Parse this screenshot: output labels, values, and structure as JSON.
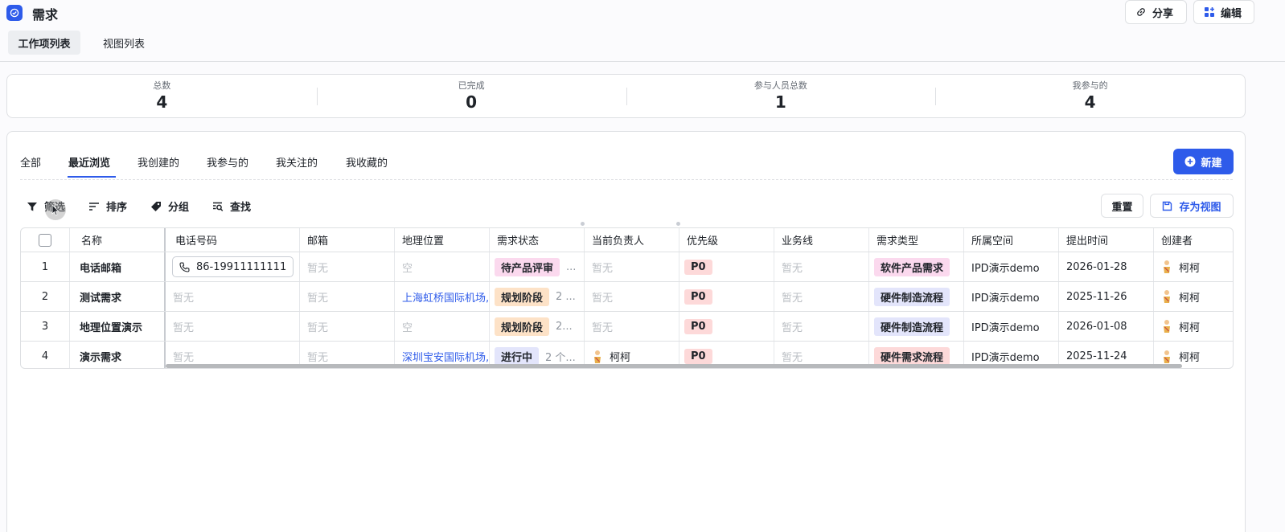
{
  "header": {
    "title": "需求",
    "share_label": "分享",
    "edit_label": "编辑"
  },
  "top_tabs": [
    {
      "label": "工作项列表"
    },
    {
      "label": "视图列表"
    }
  ],
  "stats": [
    {
      "label": "总数",
      "value": "4"
    },
    {
      "label": "已完成",
      "value": "0"
    },
    {
      "label": "参与人员总数",
      "value": "1"
    },
    {
      "label": "我参与的",
      "value": "4"
    }
  ],
  "view_tabs": [
    {
      "label": "全部"
    },
    {
      "label": "最近浏览"
    },
    {
      "label": "我创建的"
    },
    {
      "label": "我参与的"
    },
    {
      "label": "我关注的"
    },
    {
      "label": "我收藏的"
    }
  ],
  "new_label": "新建",
  "toolbar": {
    "filter": "筛选",
    "sort": "排序",
    "group": "分组",
    "find": "查找",
    "reset": "重置",
    "save_view": "存为视图"
  },
  "columns": [
    "名称",
    "电话号码",
    "邮箱",
    "地理位置",
    "需求状态",
    "当前负责人",
    "优先级",
    "业务线",
    "需求类型",
    "所属空间",
    "提出时间",
    "创建者"
  ],
  "rows": [
    {
      "no": "1",
      "name": "电话邮箱",
      "phone": "86-19911111111",
      "email": "暂无",
      "location": "空",
      "status": "待产品评审",
      "status_extra": "...",
      "owner": "暂无",
      "priority": "P0",
      "biz": "暂无",
      "type": "软件产品需求",
      "space": "IPD演示demo",
      "date": "2026-01-28",
      "creator": "柯柯"
    },
    {
      "no": "2",
      "name": "测试需求",
      "phone": "暂无",
      "email": "暂无",
      "location": "上海虹桥国际机场,",
      "status": "规划阶段",
      "status_extra": "2 ...",
      "owner": "暂无",
      "priority": "P0",
      "biz": "暂无",
      "type": "硬件制造流程",
      "space": "IPD演示demo",
      "date": "2025-11-26",
      "creator": "柯柯"
    },
    {
      "no": "3",
      "name": "地理位置演示",
      "phone": "暂无",
      "email": "暂无",
      "location": "空",
      "status": "规划阶段",
      "status_extra": "2...",
      "owner": "暂无",
      "priority": "P0",
      "biz": "暂无",
      "type": "硬件制造流程",
      "space": "IPD演示demo",
      "date": "2026-01-08",
      "creator": "柯柯"
    },
    {
      "no": "4",
      "name": "演示需求",
      "phone": "暂无",
      "email": "暂无",
      "location": "深圳宝安国际机场,",
      "status": "进行中",
      "status_extra": "2 个...",
      "owner": "柯柯",
      "priority": "P0",
      "biz": "暂无",
      "type": "硬件需求流程",
      "space": "IPD演示demo",
      "date": "2025-11-24",
      "creator": "柯柯"
    }
  ],
  "colors": {
    "brand": "#2e5bea",
    "tag_pink": "#fbd9ee",
    "tag_orange": "#fde2c7",
    "tag_lavender": "#e3e5fb",
    "tag_red": "#fdd9d9"
  }
}
